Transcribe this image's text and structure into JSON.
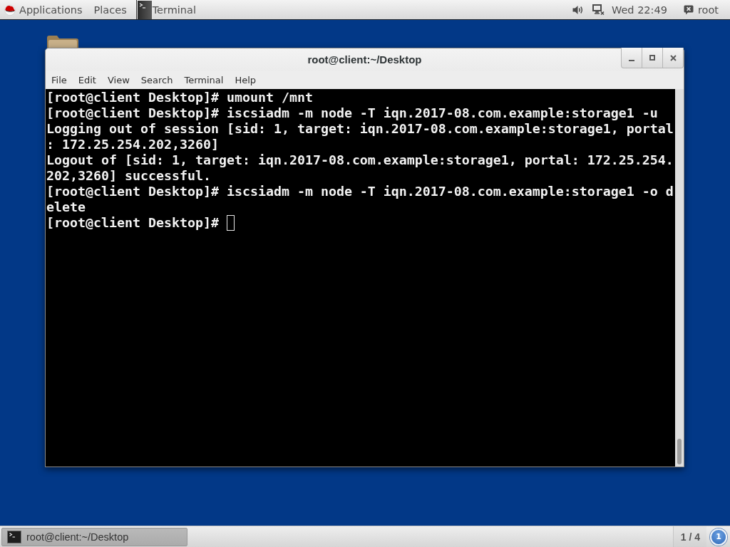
{
  "top_bar": {
    "applications_menu": "Applications",
    "places_menu": "Places",
    "app_menu": "Terminal",
    "clock": "Wed 22:49",
    "user_menu": "root"
  },
  "window": {
    "title": "root@client:~/Desktop",
    "menu": [
      "File",
      "Edit",
      "View",
      "Search",
      "Terminal",
      "Help"
    ],
    "terminal": {
      "lines": [
        {
          "text": "[root@client Desktop]# umount /mnt",
          "cursor": false
        },
        {
          "text": "[root@client Desktop]# iscsiadm -m node -T iqn.2017-08.com.example:storage1 -u",
          "cursor": false
        },
        {
          "text": "Logging out of session [sid: 1, target: iqn.2017-08.com.example:storage1, portal",
          "cursor": false
        },
        {
          "text": ": 172.25.254.202,3260]",
          "cursor": false
        },
        {
          "text": "Logout of [sid: 1, target: iqn.2017-08.com.example:storage1, portal: 172.25.254.",
          "cursor": false
        },
        {
          "text": "202,3260] successful.",
          "cursor": false
        },
        {
          "text": "[root@client Desktop]# iscsiadm -m node -T iqn.2017-08.com.example:storage1 -o d",
          "cursor": false
        },
        {
          "text": "elete",
          "cursor": false
        },
        {
          "text": "[root@client Desktop]#",
          "cursor": true
        }
      ]
    }
  },
  "taskbar": {
    "windows": [
      {
        "label": "root@client:~/Desktop",
        "selected": true
      }
    ],
    "workspace": "1 / 4",
    "notifications": "1"
  }
}
